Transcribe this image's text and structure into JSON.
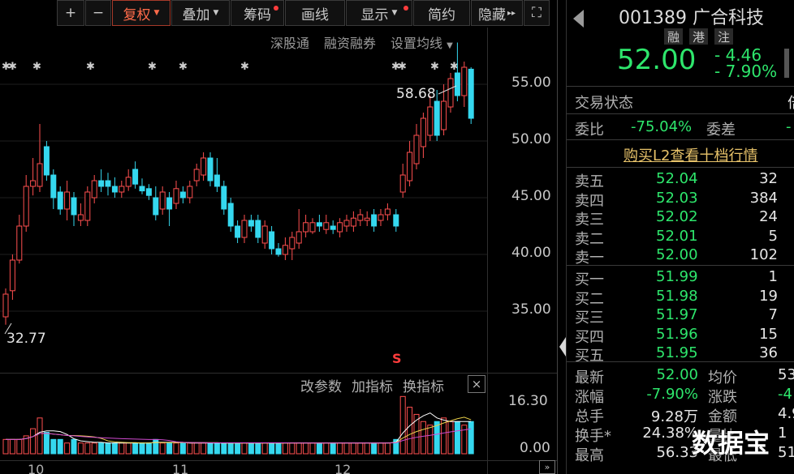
{
  "toolbar": {
    "plus": "+",
    "minus": "−",
    "fuquan": "复权",
    "diejia": "叠加",
    "chouma": "筹码",
    "huaxian": "画线",
    "xianshi": "显示",
    "jianyue": "简约",
    "yincang": "隐藏",
    "more": "▸▸",
    "fullscreen": "⛶"
  },
  "chart_links": {
    "shengutong": "深股通",
    "rongzi": "融资融券",
    "setma": "设置均线"
  },
  "chart_labels": {
    "high": "58.68",
    "low": "32.77",
    "s_marker": "S"
  },
  "indicator_links": {
    "change_param": "改参数",
    "add_indicator": "加指标",
    "switch_indicator": "换指标",
    "close": "×"
  },
  "months": [
    "10",
    "11",
    "12"
  ],
  "chart_data": {
    "type": "candlestick",
    "y_ticks": [
      "55.00",
      "50.00",
      "45.00",
      "40.00",
      "35.00"
    ],
    "ylim": [
      30,
      60
    ],
    "high_label": 58.68,
    "low_label": 32.77,
    "candles": [
      {
        "o": 34.5,
        "c": 36.5,
        "h": 37.0,
        "l": 33.8
      },
      {
        "o": 36.8,
        "c": 39.5,
        "h": 40.0,
        "l": 36.0
      },
      {
        "o": 39.5,
        "c": 42.5,
        "h": 43.5,
        "l": 39.2
      },
      {
        "o": 42.5,
        "c": 46.0,
        "h": 47.0,
        "l": 42.0
      },
      {
        "o": 46.0,
        "c": 46.5,
        "h": 48.5,
        "l": 45.2
      },
      {
        "o": 46.0,
        "c": 48.0,
        "h": 51.5,
        "l": 45.5
      },
      {
        "o": 49.5,
        "c": 47.0,
        "h": 50.0,
        "l": 46.5
      },
      {
        "o": 47.0,
        "c": 45.0,
        "h": 47.5,
        "l": 44.0
      },
      {
        "o": 45.5,
        "c": 44.0,
        "h": 46.0,
        "l": 43.5
      },
      {
        "o": 44.0,
        "c": 45.5,
        "h": 46.5,
        "l": 43.0
      },
      {
        "o": 45.0,
        "c": 43.5,
        "h": 45.5,
        "l": 42.5
      },
      {
        "o": 43.0,
        "c": 43.5,
        "h": 44.5,
        "l": 42.5
      },
      {
        "o": 43.0,
        "c": 45.5,
        "h": 46.0,
        "l": 42.5
      },
      {
        "o": 45.0,
        "c": 46.5,
        "h": 47.0,
        "l": 44.5
      },
      {
        "o": 46.5,
        "c": 46.0,
        "h": 47.5,
        "l": 45.5
      },
      {
        "o": 46.5,
        "c": 46.0,
        "h": 47.2,
        "l": 45.2
      },
      {
        "o": 46.0,
        "c": 45.5,
        "h": 46.8,
        "l": 45.0
      },
      {
        "o": 45.5,
        "c": 46.0,
        "h": 46.5,
        "l": 45.0
      },
      {
        "o": 46.0,
        "c": 46.8,
        "h": 47.5,
        "l": 45.6
      },
      {
        "o": 47.5,
        "c": 46.2,
        "h": 48.2,
        "l": 45.8
      },
      {
        "o": 46.0,
        "c": 45.6,
        "h": 46.7,
        "l": 45.3
      },
      {
        "o": 45.8,
        "c": 45.2,
        "h": 46.2,
        "l": 44.8
      },
      {
        "o": 45.0,
        "c": 43.5,
        "h": 46.0,
        "l": 43.0
      },
      {
        "o": 44.0,
        "c": 45.5,
        "h": 46.0,
        "l": 43.5
      },
      {
        "o": 45.0,
        "c": 44.0,
        "h": 45.5,
        "l": 42.5
      },
      {
        "o": 44.5,
        "c": 45.8,
        "h": 46.5,
        "l": 44.0
      },
      {
        "o": 45.5,
        "c": 45.0,
        "h": 46.0,
        "l": 44.5
      },
      {
        "o": 45.0,
        "c": 46.0,
        "h": 46.5,
        "l": 44.5
      },
      {
        "o": 46.5,
        "c": 47.5,
        "h": 48.0,
        "l": 46.0
      },
      {
        "o": 47.0,
        "c": 48.5,
        "h": 49.0,
        "l": 46.5
      },
      {
        "o": 48.5,
        "c": 46.5,
        "h": 49.0,
        "l": 46.0
      },
      {
        "o": 47.0,
        "c": 46.0,
        "h": 48.5,
        "l": 45.5
      },
      {
        "o": 46.0,
        "c": 44.0,
        "h": 46.5,
        "l": 43.5
      },
      {
        "o": 44.5,
        "c": 42.5,
        "h": 45.0,
        "l": 42.0
      },
      {
        "o": 42.5,
        "c": 41.5,
        "h": 43.0,
        "l": 41.0
      },
      {
        "o": 41.5,
        "c": 43.0,
        "h": 43.5,
        "l": 41.0
      },
      {
        "o": 43.0,
        "c": 42.5,
        "h": 43.5,
        "l": 42.0
      },
      {
        "o": 43.0,
        "c": 41.5,
        "h": 43.5,
        "l": 41.0
      },
      {
        "o": 41.0,
        "c": 42.5,
        "h": 43.0,
        "l": 40.5
      },
      {
        "o": 42.0,
        "c": 40.5,
        "h": 42.5,
        "l": 40.0
      },
      {
        "o": 40.5,
        "c": 40.0,
        "h": 41.0,
        "l": 39.8
      },
      {
        "o": 40.0,
        "c": 40.8,
        "h": 41.5,
        "l": 39.5
      },
      {
        "o": 40.5,
        "c": 41.5,
        "h": 42.0,
        "l": 39.5
      },
      {
        "o": 41.0,
        "c": 42.0,
        "h": 44.0,
        "l": 40.5
      },
      {
        "o": 42.0,
        "c": 42.8,
        "h": 43.5,
        "l": 41.5
      },
      {
        "o": 42.0,
        "c": 42.8,
        "h": 43.2,
        "l": 41.8
      },
      {
        "o": 42.8,
        "c": 42.5,
        "h": 43.5,
        "l": 42.0
      },
      {
        "o": 42.2,
        "c": 42.8,
        "h": 43.5,
        "l": 41.8
      },
      {
        "o": 42.5,
        "c": 42.2,
        "h": 43.0,
        "l": 41.8
      },
      {
        "o": 42.0,
        "c": 42.8,
        "h": 43.2,
        "l": 41.5
      },
      {
        "o": 42.5,
        "c": 43.0,
        "h": 43.5,
        "l": 42.0
      },
      {
        "o": 42.5,
        "c": 43.2,
        "h": 43.8,
        "l": 42.0
      },
      {
        "o": 43.0,
        "c": 43.5,
        "h": 44.0,
        "l": 42.5
      },
      {
        "o": 43.0,
        "c": 43.2,
        "h": 43.8,
        "l": 42.5
      },
      {
        "o": 43.5,
        "c": 42.5,
        "h": 44.0,
        "l": 42.0
      },
      {
        "o": 43.0,
        "c": 43.5,
        "h": 44.0,
        "l": 42.5
      },
      {
        "o": 43.5,
        "c": 44.0,
        "h": 44.5,
        "l": 43.0
      },
      {
        "o": 43.5,
        "c": 42.5,
        "h": 44.0,
        "l": 42.0
      },
      {
        "o": 45.5,
        "c": 47.0,
        "h": 48.0,
        "l": 45.0
      },
      {
        "o": 46.5,
        "c": 49.0,
        "h": 50.0,
        "l": 46.0
      },
      {
        "o": 48.0,
        "c": 50.5,
        "h": 51.5,
        "l": 47.5
      },
      {
        "o": 49.5,
        "c": 52.0,
        "h": 52.5,
        "l": 48.5
      },
      {
        "o": 50.5,
        "c": 53.0,
        "h": 54.0,
        "l": 50.0
      },
      {
        "o": 53.5,
        "c": 50.5,
        "h": 54.5,
        "l": 50.0
      },
      {
        "o": 51.0,
        "c": 53.5,
        "h": 55.0,
        "l": 50.5
      },
      {
        "o": 53.0,
        "c": 55.5,
        "h": 56.0,
        "l": 52.5
      },
      {
        "o": 56.0,
        "c": 54.0,
        "h": 58.68,
        "l": 53.5
      },
      {
        "o": 54.0,
        "c": 56.5,
        "h": 57.0,
        "l": 53.0
      },
      {
        "o": 56.33,
        "c": 52.0,
        "h": 56.5,
        "l": 51.5
      }
    ],
    "volume_ticks": [
      "16.30",
      "0.00"
    ],
    "volume": [
      4,
      4,
      4,
      5,
      7,
      10,
      6,
      4,
      4,
      3,
      4,
      3,
      3,
      3,
      3,
      3,
      3,
      3,
      3,
      3,
      3,
      3,
      4,
      3,
      3,
      3,
      3,
      3,
      3,
      3,
      3,
      3,
      3,
      3,
      3,
      3,
      3,
      3,
      3,
      3,
      3,
      3,
      3,
      3,
      3,
      3,
      3,
      3,
      3,
      3,
      3,
      3,
      3,
      3,
      3,
      3,
      3,
      4,
      16,
      13,
      11,
      9,
      8,
      9,
      10,
      9,
      9,
      8,
      9
    ]
  },
  "stock": {
    "code_name": "001389 广合科技",
    "tags": [
      "融",
      "港",
      "注"
    ],
    "price": "52.00",
    "change": "- 4.46",
    "change_pct": "- 7.90%"
  },
  "panel": {
    "trade_status_label": "交易状态",
    "trade_status_value": "倍",
    "weibi_label": "委比",
    "weibi_value": "-75.04%",
    "weicha_label": "委差",
    "weicha_value": "-",
    "l2_link": "购买L2查看十档行情"
  },
  "order_book": {
    "asks": [
      {
        "label": "卖五",
        "price": "52.04",
        "vol": "32"
      },
      {
        "label": "卖四",
        "price": "52.03",
        "vol": "384"
      },
      {
        "label": "卖三",
        "price": "52.02",
        "vol": "24"
      },
      {
        "label": "卖二",
        "price": "52.01",
        "vol": "5"
      },
      {
        "label": "卖一",
        "price": "52.00",
        "vol": "102"
      }
    ],
    "bids": [
      {
        "label": "买一",
        "price": "51.99",
        "vol": "1"
      },
      {
        "label": "买二",
        "price": "51.98",
        "vol": "19"
      },
      {
        "label": "买三",
        "price": "51.97",
        "vol": "7"
      },
      {
        "label": "买四",
        "price": "51.96",
        "vol": "15"
      },
      {
        "label": "买五",
        "price": "51.95",
        "vol": "36"
      }
    ]
  },
  "stats": [
    {
      "l1": "最新",
      "v1": "52.00",
      "l2": "均价",
      "v2": "53"
    },
    {
      "l1": "涨幅",
      "v1": "-7.90%",
      "l2": "涨跌",
      "v2": "-4"
    },
    {
      "l1": "总手",
      "v1": "9.28万",
      "l2": "金额",
      "v2": "4.9"
    },
    {
      "l1": "换手*",
      "v1": "24.38%",
      "l2": "量比",
      "v2": "1"
    },
    {
      "l1": "最高",
      "v1": "56.33",
      "l2": "最低",
      "v2": "51"
    }
  ],
  "watermark": "数据宝"
}
